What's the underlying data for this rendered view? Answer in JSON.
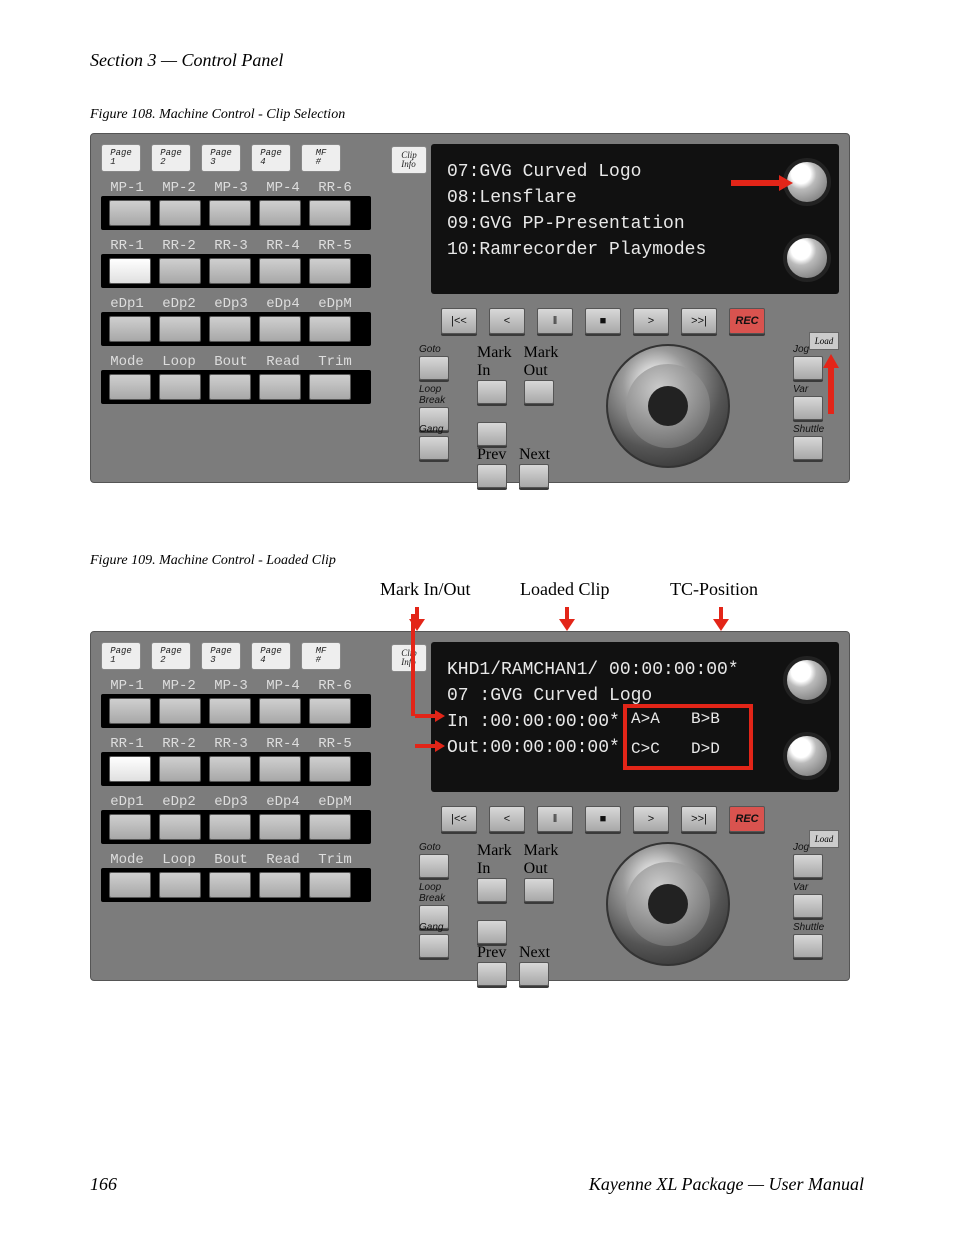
{
  "header": {
    "section": "Section 3 — Control Panel"
  },
  "fig108": {
    "caption": "Figure 108.  Machine Control - Clip Selection"
  },
  "fig109": {
    "caption": "Figure 109.  Machine Control - Loaded Clip",
    "annot": {
      "markInOut": "Mark In/Out",
      "loadedClip": "Loaded Clip",
      "tcPosition": "TC-Position"
    }
  },
  "footer": {
    "page": "166",
    "doc": "Kayenne XL Package — User Manual"
  },
  "panel": {
    "pageButtons": [
      "Page\n1",
      "Page\n2",
      "Page\n3",
      "Page\n4",
      "MF\n#"
    ],
    "clipInfo": "Clip\nInfo",
    "banks": {
      "r1": [
        "MP-1",
        "MP-2",
        "MP-3",
        "MP-4",
        "RR-6"
      ],
      "r2": [
        "RR-1",
        "RR-2",
        "RR-3",
        "RR-4",
        "RR-5"
      ],
      "r3": [
        "eDp1",
        "eDp2",
        "eDp3",
        "eDp4",
        "eDpM"
      ],
      "r4": [
        "Mode",
        "Loop",
        "Bout",
        "Read",
        "Trim"
      ]
    },
    "transport": {
      "keys": [
        "|<<",
        "<",
        "‖",
        "■",
        ">",
        ">>|"
      ],
      "rec": "REC",
      "load": "Load",
      "left": [
        "Goto",
        "Loop\nBreak",
        "Gang"
      ],
      "mid": [
        [
          "Mark\nIn",
          "Mark\nOut"
        ],
        [
          "",
          ""
        ],
        [
          "Prev",
          "Next"
        ]
      ],
      "right": [
        "Jog",
        "Var",
        "Shuttle"
      ]
    }
  },
  "display1": {
    "l1": "07:GVG Curved Logo",
    "l2": "08:Lensflare",
    "l3": "09:GVG PP-Presentation",
    "l4": "10:Ramrecorder Playmodes"
  },
  "display2": {
    "l1": "KHD1/RAMCHAN1/ 00:00:00:00*",
    "l2": "07 :GVG Curved Logo",
    "l3": "In :00:00:00:00*",
    "l4": "Out:00:00:00:00*",
    "aa": "A>A",
    "bb": "B>B",
    "cc": "C>C",
    "dd": "D>D"
  }
}
